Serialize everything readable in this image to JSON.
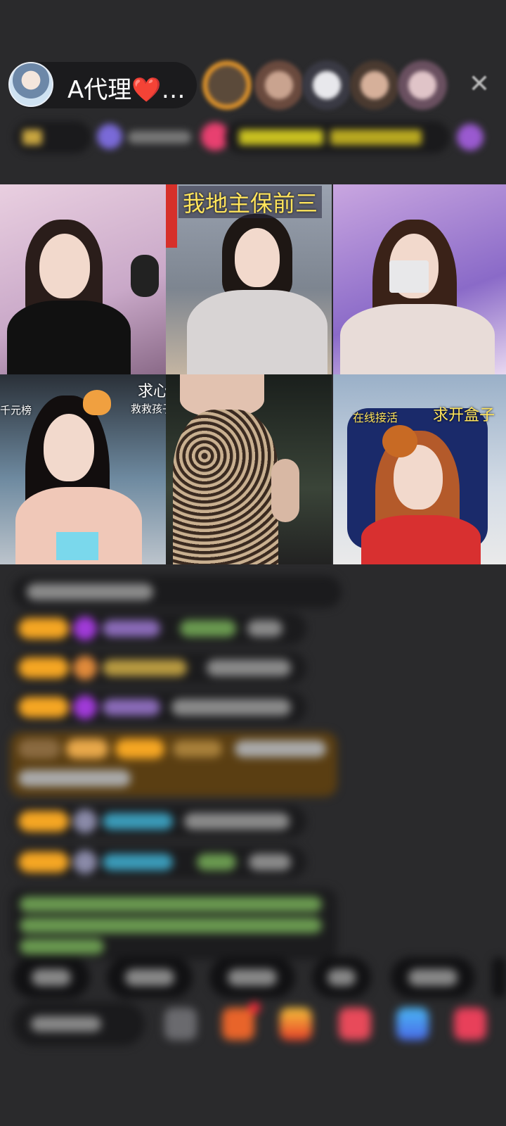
{
  "host": {
    "name": "A代理❤️…"
  },
  "tiles": [
    {
      "overlay": ""
    },
    {
      "overlay": "我地主保前三"
    },
    {
      "overlay": ""
    },
    {
      "overlay_top": "求心",
      "overlay_sub": "救救孩子",
      "overlay_left": "千元榜"
    },
    {
      "overlay": ""
    },
    {
      "overlay_left": "在线接活",
      "overlay_right": "求开盒子"
    }
  ],
  "colors": {
    "background": "#2a2a2c",
    "badge": "#f5a623",
    "overlay_text_yellow": "#ffe45c"
  },
  "icons": [
    "close-icon",
    "gift-icon",
    "fan-icon",
    "heart-icon",
    "share-icon",
    "more-icon"
  ]
}
